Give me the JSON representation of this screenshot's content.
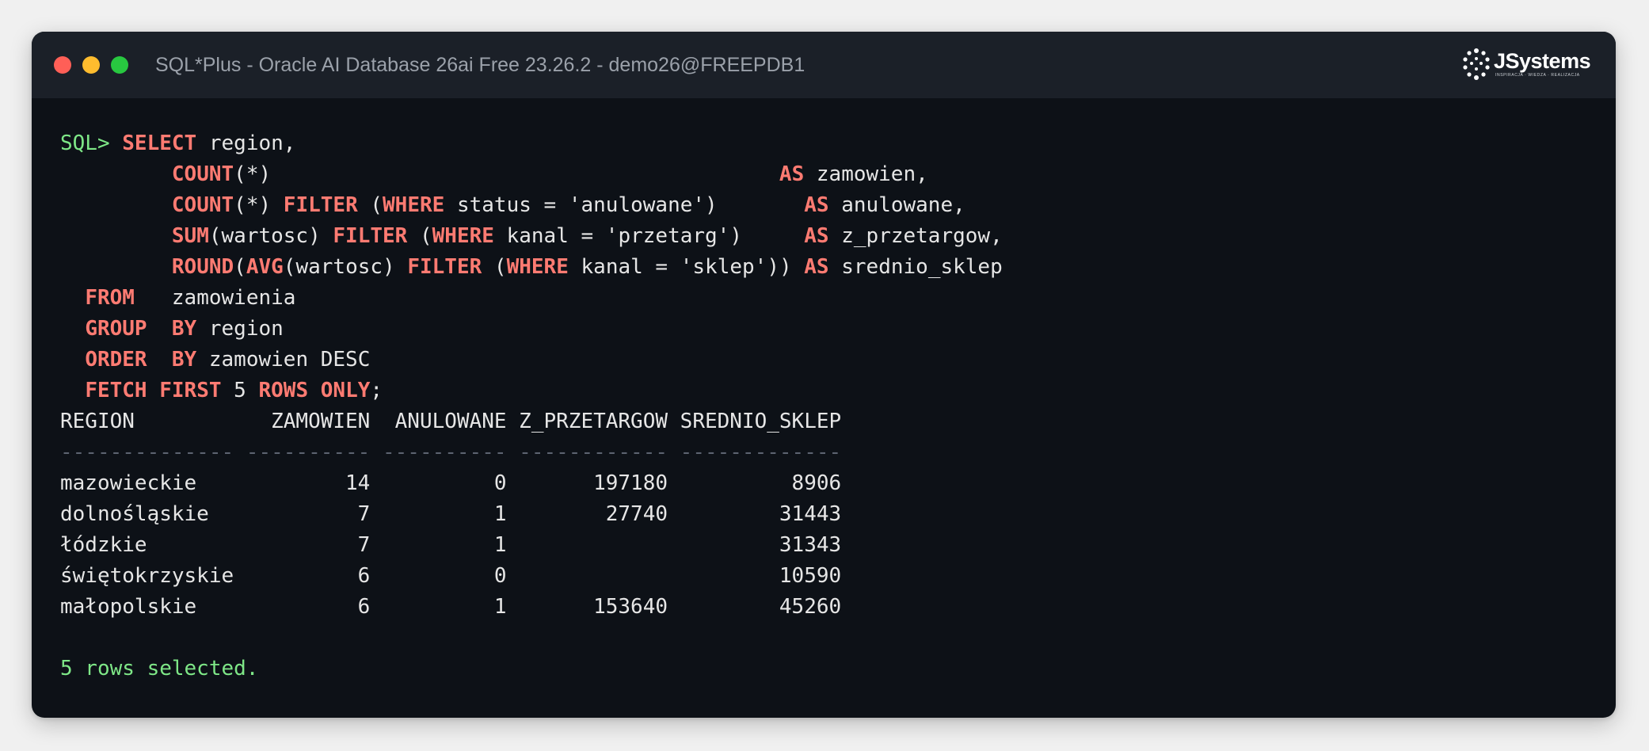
{
  "window": {
    "title": "SQL*Plus - Oracle AI Database 26ai Free 23.26.2 - demo26@FREEPDB1",
    "logo_text": "JSystems",
    "logo_tagline": "INSPIRACJA · WIEDZA · REALIZACJA"
  },
  "colors": {
    "prompt": "#7ee787",
    "keyword": "#ff7b72",
    "text": "#e6e6e6",
    "background": "#0d1117",
    "titlebar": "#1b2028"
  },
  "query": {
    "prompt": "SQL> ",
    "lines": [
      [
        [
          "kw",
          "SELECT"
        ],
        [
          "p",
          " region,"
        ]
      ],
      [
        [
          "p",
          "         "
        ],
        [
          "kw",
          "COUNT"
        ],
        [
          "p",
          "(*)                                         "
        ],
        [
          "kw",
          "AS"
        ],
        [
          "p",
          " zamowien,"
        ]
      ],
      [
        [
          "p",
          "         "
        ],
        [
          "kw",
          "COUNT"
        ],
        [
          "p",
          "(*) "
        ],
        [
          "kw",
          "FILTER"
        ],
        [
          "p",
          " ("
        ],
        [
          "kw",
          "WHERE"
        ],
        [
          "p",
          " status = 'anulowane')       "
        ],
        [
          "kw",
          "AS"
        ],
        [
          "p",
          " anulowane,"
        ]
      ],
      [
        [
          "p",
          "         "
        ],
        [
          "kw",
          "SUM"
        ],
        [
          "p",
          "(wartosc) "
        ],
        [
          "kw",
          "FILTER"
        ],
        [
          "p",
          " ("
        ],
        [
          "kw",
          "WHERE"
        ],
        [
          "p",
          " kanal = 'przetarg')     "
        ],
        [
          "kw",
          "AS"
        ],
        [
          "p",
          " z_przetargow,"
        ]
      ],
      [
        [
          "p",
          "         "
        ],
        [
          "kw",
          "ROUND"
        ],
        [
          "p",
          "("
        ],
        [
          "kw",
          "AVG"
        ],
        [
          "p",
          "(wartosc) "
        ],
        [
          "kw",
          "FILTER"
        ],
        [
          "p",
          " ("
        ],
        [
          "kw",
          "WHERE"
        ],
        [
          "p",
          " kanal = 'sklep')) "
        ],
        [
          "kw",
          "AS"
        ],
        [
          "p",
          " srednio_sklep"
        ]
      ],
      [
        [
          "p",
          "  "
        ],
        [
          "kw",
          "FROM"
        ],
        [
          "p",
          "   zamowienia"
        ]
      ],
      [
        [
          "p",
          "  "
        ],
        [
          "kw",
          "GROUP"
        ],
        [
          "p",
          "  "
        ],
        [
          "kw",
          "BY"
        ],
        [
          "p",
          " region"
        ]
      ],
      [
        [
          "p",
          "  "
        ],
        [
          "kw",
          "ORDER"
        ],
        [
          "p",
          "  "
        ],
        [
          "kw",
          "BY"
        ],
        [
          "p",
          " zamowien DESC"
        ]
      ],
      [
        [
          "p",
          "  "
        ],
        [
          "kw",
          "FETCH"
        ],
        [
          "p",
          " "
        ],
        [
          "kw",
          "FIRST"
        ],
        [
          "p",
          " 5 "
        ],
        [
          "kw",
          "ROWS"
        ],
        [
          "p",
          " "
        ],
        [
          "kw",
          "ONLY"
        ],
        [
          "p",
          ";"
        ]
      ]
    ]
  },
  "result": {
    "header": "REGION           ZAMOWIEN  ANULOWANE Z_PRZETARGOW SREDNIO_SKLEP",
    "dashes": "-------------- ---------- ---------- ------------ -------------",
    "rows": [
      "mazowieckie            14          0       197180          8906",
      "dolnośląskie            7          1        27740         31443",
      "łódzkie                 7          1                      31343",
      "świętokrzyskie          6          0                      10590",
      "małopolskie             6          1       153640         45260"
    ],
    "summary": "5 rows selected."
  }
}
